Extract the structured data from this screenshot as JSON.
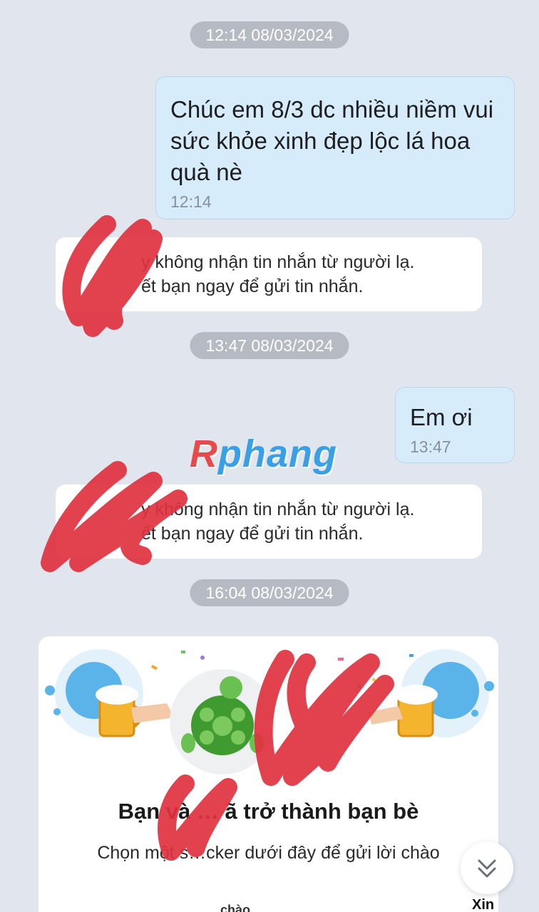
{
  "messages": {
    "ts1": "12:14 08/03/2024",
    "msg1_text": "Chúc em 8/3 dc nhiều niềm vui sức khỏe xinh đẹp lộc lá hoa quà nè",
    "msg1_time": "12:14",
    "notice1_line1": "y không nhận tin nhắn từ người lạ.",
    "notice1_line2": "ết bạn ngay để gửi tin nhắn.",
    "ts2": "13:47 08/03/2024",
    "msg2_text": "Em ơi",
    "msg2_time": "13:47",
    "notice2_line1": "y không nhận tin nhắn từ người lạ.",
    "notice2_line2": "ết bạn ngay để gửi tin nhắn.",
    "ts3": "16:04 08/03/2024"
  },
  "friend_card": {
    "title": "Bạn và … ã trở thành bạn bè",
    "subtitle": "Chọn một s…cker dưới đây để gửi lời chào",
    "sticker_hint_1": "chào",
    "sticker_hint_2": "Xin"
  },
  "watermark": {
    "first": "R",
    "rest": "phang"
  },
  "colors": {
    "background": "#e1e6ee",
    "sent_bubble": "#d6ecfb",
    "timestamp_pill": "#b6bbc3",
    "redaction": "#e0323f"
  },
  "icons": {
    "scroll_down": "double-chevron-down-icon"
  }
}
